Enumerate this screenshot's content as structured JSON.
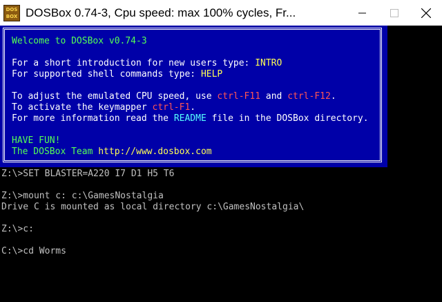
{
  "window": {
    "title": "DOSBox 0.74-3, Cpu speed: max 100% cycles, Fr...",
    "icon_label_top": "DOS",
    "icon_label_bottom": "BOX",
    "icon": "dosbox-app-icon",
    "controls": [
      "minimize-icon",
      "maximize-icon",
      "close-icon"
    ]
  },
  "banner": {
    "welcome": "Welcome to DOSBox v0.74-3",
    "intro_pre": "For a short introduction for new users type: ",
    "intro_cmd": "INTRO",
    "help_pre": "For supported shell commands type: ",
    "help_cmd": "HELP",
    "cpu_pre": "To adjust the emulated CPU speed, use ",
    "cpu_key1": "ctrl-F11",
    "cpu_and": " and ",
    "cpu_key2": "ctrl-F12",
    "cpu_end": ".",
    "keymap_pre": "To activate the keymapper ",
    "keymap_key": "ctrl-F1",
    "keymap_end": ".",
    "readme_pre": "For more information read the ",
    "readme_word": "README",
    "readme_end": " file in the DOSBox directory.",
    "have_fun": "HAVE FUN!",
    "team_pre": "The DOSBox Team ",
    "team_url": "http://www.dosbox.com"
  },
  "terminal": {
    "lines": [
      "Z:\\>SET BLASTER=A220 I7 D1 H5 T6",
      "",
      "Z:\\>mount c: c:\\GamesNostalgia",
      "Drive C is mounted as local directory c:\\GamesNostalgia\\",
      "",
      "Z:\\>c:",
      "",
      "C:\\>cd Worms"
    ]
  },
  "colors": {
    "banner_bg": "#0000a8",
    "green": "#55ff55",
    "yellow": "#ffff55",
    "red": "#ff5555",
    "cyan": "#55ffff",
    "terminal_text": "#c0c0c0"
  }
}
